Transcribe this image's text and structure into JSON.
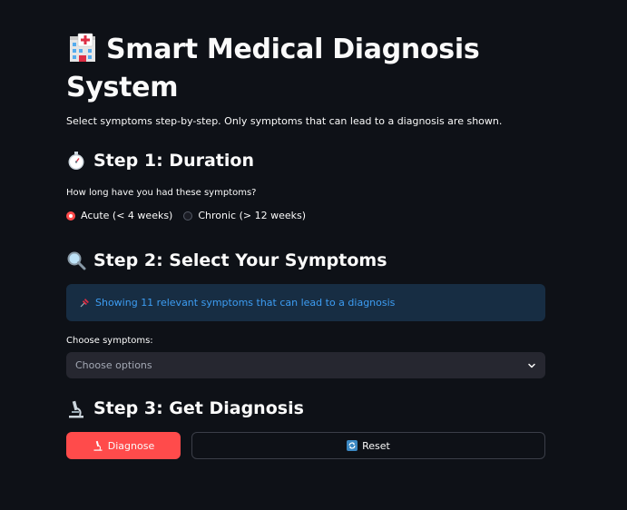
{
  "header": {
    "title_line1": "Smart Medical Diagnosis",
    "title_line2": "System",
    "title_icon": "hospital-icon",
    "subtitle": "Select symptoms step-by-step. Only symptoms that can lead to a diagnosis are shown."
  },
  "step1": {
    "icon": "stopwatch-icon",
    "heading": "Step 1: Duration",
    "question": "How long have you had these symptoms?",
    "options": [
      {
        "label": "Acute (< 4 weeks)",
        "selected": true
      },
      {
        "label": "Chronic (> 12 weeks)",
        "selected": false
      }
    ]
  },
  "step2": {
    "icon": "magnifier-icon",
    "heading": "Step 2: Select Your Symptoms",
    "info_icon": "pushpin-icon",
    "info": "Showing 11 relevant symptoms that can lead to a diagnosis",
    "select_label": "Choose symptoms:",
    "select_placeholder": "Choose options"
  },
  "step3": {
    "icon": "microscope-icon",
    "heading": "Step 3: Get Diagnosis",
    "diagnose_label": "Diagnose",
    "reset_label": "Reset"
  },
  "colors": {
    "background": "#0e1117",
    "primary": "#ff4b4b",
    "info_bg": "#172d43",
    "info_text": "#3d9df3",
    "input_bg": "#262730"
  }
}
